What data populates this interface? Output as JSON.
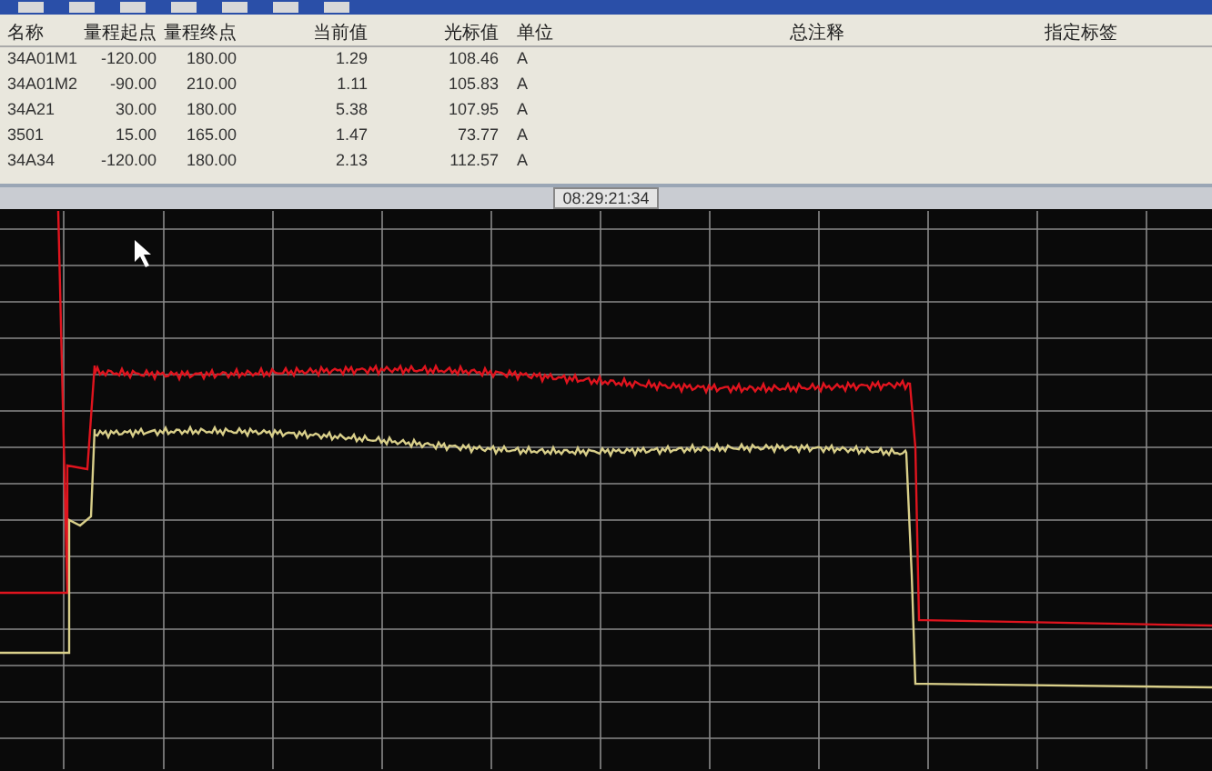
{
  "table": {
    "columns": [
      "名称",
      "量程起点",
      "量程终点",
      "当前值",
      "光标值",
      "单位",
      "总注释",
      "指定标签"
    ],
    "rows": [
      [
        "34A01M1",
        "-120.00",
        "180.00",
        "1.29",
        "108.46",
        "A"
      ],
      [
        "34A01M2",
        "-90.00",
        "210.00",
        "1.11",
        "105.83",
        "A"
      ],
      [
        "34A21",
        "30.00",
        "180.00",
        "5.38",
        "107.95",
        "A"
      ],
      [
        "3501",
        "15.00",
        "165.00",
        "1.47",
        "73.77",
        "A"
      ],
      [
        "34A34",
        "-120.00",
        "180.00",
        "2.13",
        "112.57",
        "A"
      ]
    ]
  },
  "timestamp": "08:29:21:34"
}
